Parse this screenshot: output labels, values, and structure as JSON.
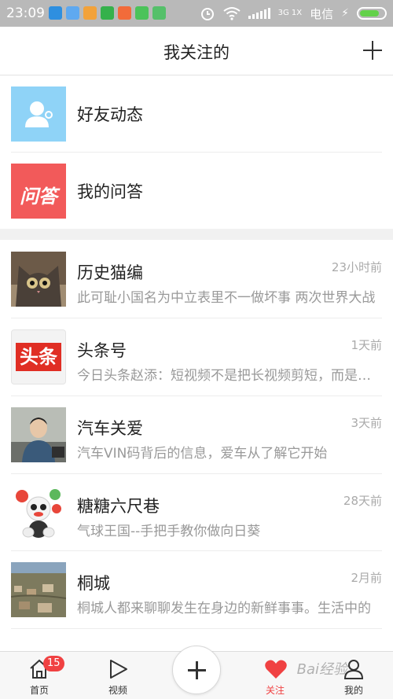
{
  "status_bar": {
    "time": "23:09",
    "carrier": "电信",
    "network": "3G 1X",
    "icons": [
      "notif-1",
      "notif-2",
      "notif-3",
      "notif-4",
      "notif-5",
      "notif-6",
      "notif-7",
      "alarm-icon",
      "wifi-icon",
      "signal-icon",
      "battery-icon"
    ]
  },
  "header": {
    "title": "我关注的",
    "add_icon": "plus-icon"
  },
  "entries": [
    {
      "label": "好友动态",
      "icon": "friends-icon",
      "color": "#8fd3f7"
    },
    {
      "label": "我的问答",
      "icon_text": "问答",
      "color": "#f25a5a"
    }
  ],
  "list": [
    {
      "name": "历史猫编",
      "desc": "此可耻小国名为中立表里不一做坏事 两次世界大战",
      "time": "23小时前"
    },
    {
      "name": "头条号",
      "desc": "今日头条赵添：短视频不是把长视频剪短，而是要有",
      "time": "1天前",
      "avatar_text": "头条"
    },
    {
      "name": "汽车关爱",
      "desc": "汽车VIN码背后的信息，爱车从了解它开始",
      "time": "3天前"
    },
    {
      "name": "糖糖六尺巷",
      "desc": "气球王国--手把手教你做向日葵",
      "time": "28天前"
    },
    {
      "name": "桐城",
      "desc": "桐城人都来聊聊发生在身边的新鲜事事。生活中的",
      "time": "2月前"
    }
  ],
  "bottom_nav": {
    "home": {
      "label": "首页",
      "badge": "15"
    },
    "video": {
      "label": "视频"
    },
    "publish": {
      "icon": "plus-icon"
    },
    "follow": {
      "label": "关注",
      "active_color": "#f04142"
    },
    "mine": {
      "label": "我的"
    },
    "watermark": "Bai经验"
  }
}
